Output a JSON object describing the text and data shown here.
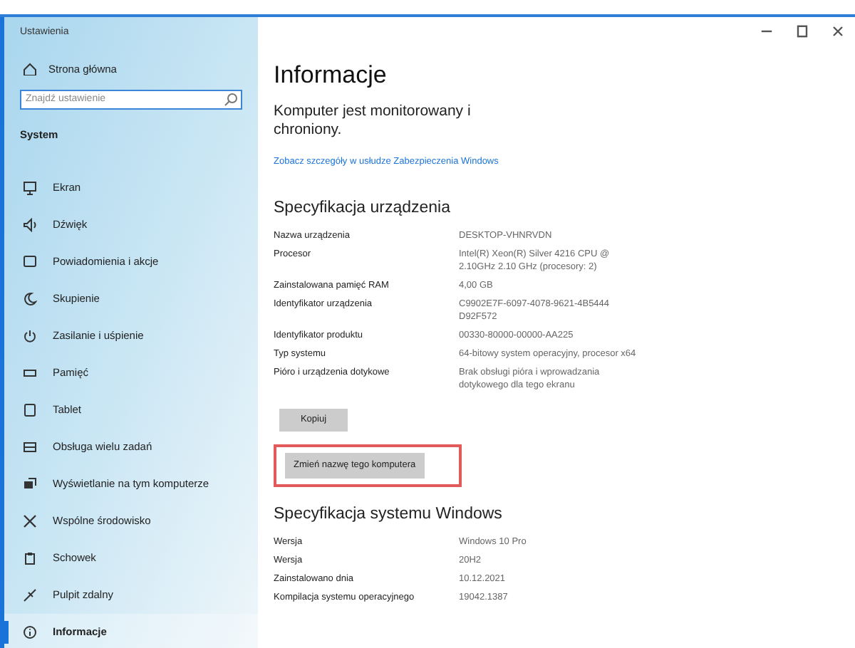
{
  "window": {
    "title": "Ustawienia"
  },
  "sidebar": {
    "home": "Strona główna",
    "search": {
      "placeholder": "Znajdź ustawienie"
    },
    "section": "System",
    "items": [
      {
        "label": "Ekran",
        "selected": false
      },
      {
        "label": "Dźwięk",
        "selected": false
      },
      {
        "label": "Powiadomienia i akcje",
        "selected": false
      },
      {
        "label": "Skupienie",
        "selected": false
      },
      {
        "label": "Zasilanie i uśpienie",
        "selected": false
      },
      {
        "label": "Pamięć",
        "selected": false
      },
      {
        "label": "Tablet",
        "selected": false
      },
      {
        "label": "Obsługa wielu zadań",
        "selected": false
      },
      {
        "label": "Wyświetlanie na tym komputerze",
        "selected": false
      },
      {
        "label": "Wspólne środowisko",
        "selected": false
      },
      {
        "label": "Schowek",
        "selected": false
      },
      {
        "label": "Pulpit zdalny",
        "selected": false
      },
      {
        "label": "Informacje",
        "selected": true
      }
    ]
  },
  "main": {
    "title": "Informacje",
    "status": "Komputer jest monitorowany i chroniony.",
    "link": "Zobacz szczegóły w usłudze Zabezpieczenia Windows",
    "device_spec": {
      "heading": "Specyfikacja urządzenia",
      "rows": [
        {
          "label": "Nazwa urządzenia",
          "value": "DESKTOP-VHNRVDN"
        },
        {
          "label": "Procesor",
          "value": "Intel(R) Xeon(R) Silver 4216 CPU @ 2.10GHz   2.10 GHz  (procesory: 2)"
        },
        {
          "label": "Zainstalowana pamięć RAM",
          "value": "4,00 GB"
        },
        {
          "label": "Identyfikator urządzenia",
          "value": "C9902E7F-6097-4078-9621-4B5444 D92F572"
        },
        {
          "label": "Identyfikator produktu",
          "value": "00330-80000-00000-AA225"
        },
        {
          "label": "Typ systemu",
          "value": "64-bitowy system operacyjny, procesor x64"
        },
        {
          "label": "Pióro i urządzenia dotykowe",
          "value": "Brak obsługi pióra i wprowadzania dotykowego dla tego ekranu"
        }
      ]
    },
    "copy_button": "Kopiuj",
    "rename_button": {
      "label": "Zmień nazwę tego komputera",
      "highlighted": true
    },
    "windows_spec": {
      "heading": "Specyfikacja systemu Windows",
      "rows": [
        {
          "label": "Wersja",
          "value": "Windows 10 Pro"
        },
        {
          "label": "Wersja",
          "value": "20H2"
        },
        {
          "label": "Zainstalowano dnia",
          "value": "10.12.2021"
        },
        {
          "label": "Kompilacja systemu operacyjnego",
          "value": "19042.1387"
        }
      ]
    }
  }
}
